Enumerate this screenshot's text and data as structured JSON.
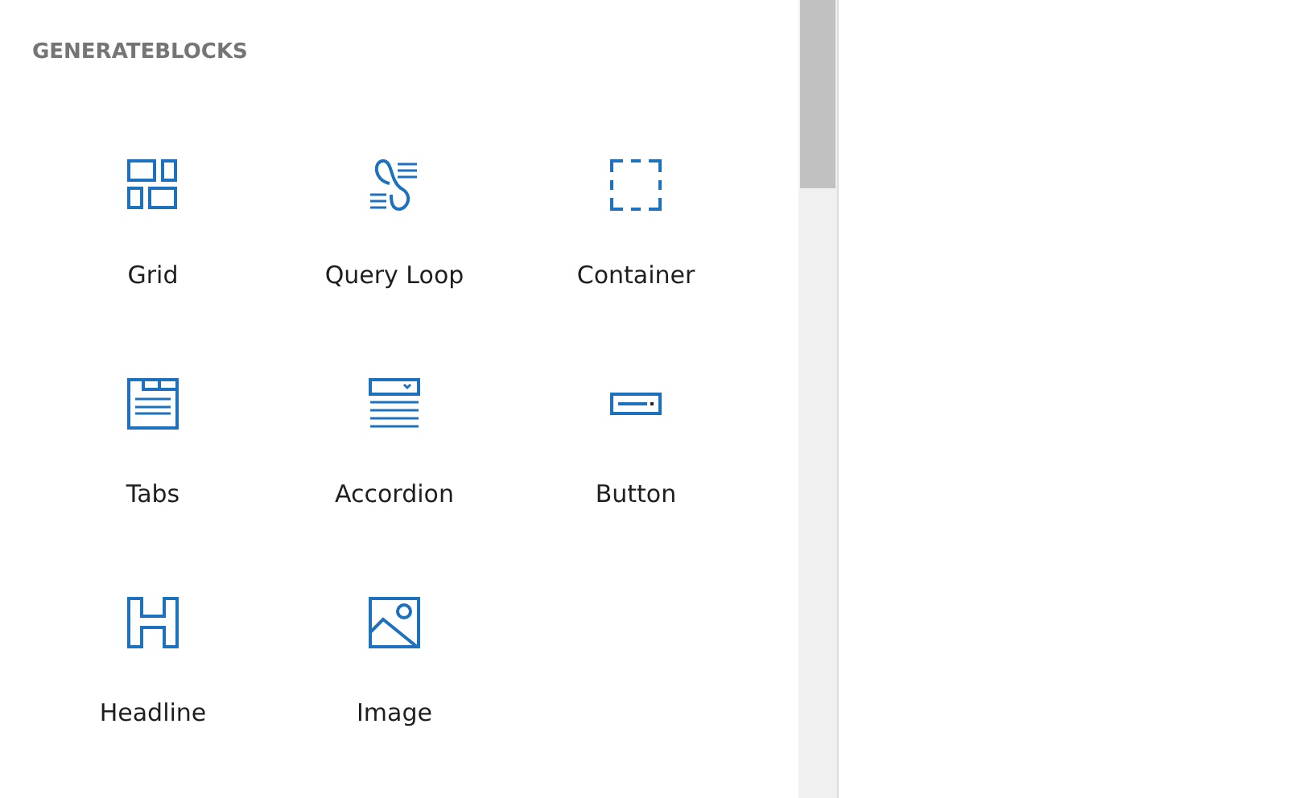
{
  "section_title": "GENERATEBLOCKS",
  "blocks": [
    {
      "label": "Grid",
      "kind": "grid"
    },
    {
      "label": "Query Loop",
      "kind": "query-loop"
    },
    {
      "label": "Container",
      "kind": "container"
    },
    {
      "label": "Tabs",
      "kind": "tabs"
    },
    {
      "label": "Accordion",
      "kind": "accordion"
    },
    {
      "label": "Button",
      "kind": "button"
    },
    {
      "label": "Headline",
      "kind": "headline"
    },
    {
      "label": "Image",
      "kind": "image"
    }
  ]
}
